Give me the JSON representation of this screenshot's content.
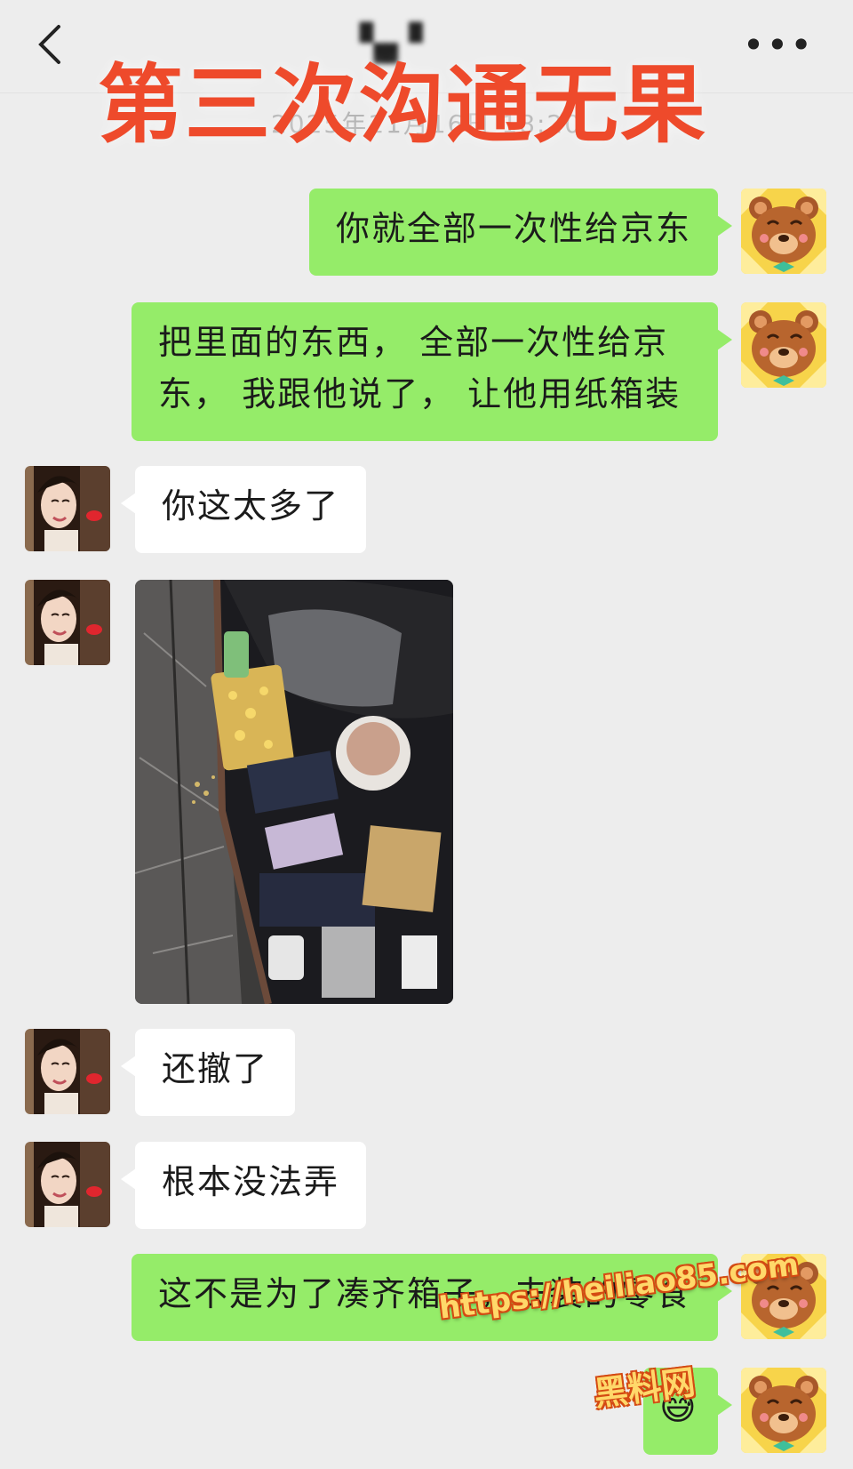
{
  "header": {
    "contact_name": "▚▖▘",
    "more_icon": "more-dots-icon",
    "back_icon": "chevron-left-icon",
    "overlay_title": "第三次沟通无果",
    "timestamp": "2025年11月16日 18:20"
  },
  "messages": [
    {
      "side": "out",
      "text": "你就全部一次性给京东"
    },
    {
      "side": "out",
      "line1": "把里面的东西， 全部一次性给京",
      "line2": "东， 我跟他说了， 让他用纸箱装"
    },
    {
      "side": "in",
      "text": "你这太多了"
    },
    {
      "side": "in",
      "type": "image",
      "desc": "photo-suitcase"
    },
    {
      "side": "in",
      "text": "还撤了"
    },
    {
      "side": "in",
      "text": "根本没法弄"
    },
    {
      "side": "out",
      "text": "这不是为了凑齐箱子，去装的零食"
    },
    {
      "side": "out",
      "type": "emoji",
      "text": "😅"
    }
  ],
  "watermark": {
    "url": "https://heiliao85.com",
    "brand": "黑料网"
  },
  "colors": {
    "bg": "#ededed",
    "bubble_out": "#95ec69",
    "bubble_in": "#ffffff",
    "overlay_red": "#ee4a2b"
  }
}
